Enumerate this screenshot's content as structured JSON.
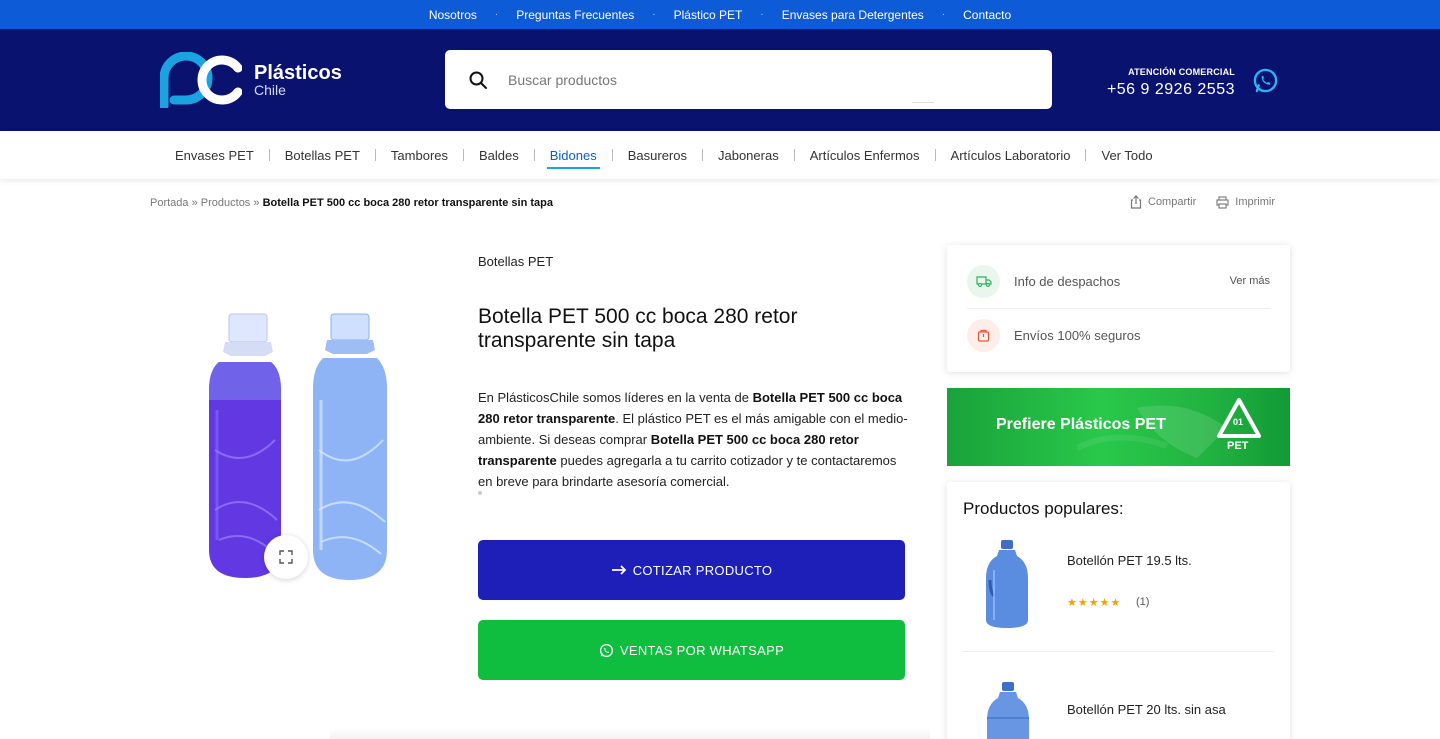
{
  "topbar": {
    "links": [
      "Nosotros",
      "Preguntas Frecuentes",
      "Plástico PET",
      "Envases para Detergentes",
      "Contacto"
    ]
  },
  "header": {
    "logo_line1": "Plásticos",
    "logo_line2": "Chile",
    "search_placeholder": "Buscar productos",
    "contact_label": "ATENCIÓN COMERCIAL",
    "contact_phone": "+56 9 2926 2553"
  },
  "catnav": {
    "items": [
      "Envases PET",
      "Botellas PET",
      "Tambores",
      "Baldes",
      "Bidones",
      "Basureros",
      "Jaboneras",
      "Artículos Enfermos",
      "Artículos Laboratorio",
      "Ver Todo"
    ],
    "active": "Bidones"
  },
  "breadcrumb": {
    "home": "Portada",
    "sep": "»",
    "products": "Productos",
    "current": "Botella PET 500 cc boca 280 retor transparente sin tapa"
  },
  "tools": {
    "share": "Compartir",
    "print": "Imprimir"
  },
  "product": {
    "category": "Botellas PET",
    "title": "Botella PET 500 cc boca 280 retor transparente sin tapa",
    "desc_1": "En PlásticosChile somos líderes en la venta de ",
    "desc_b1": "Botella PET 500 cc boca 280 retor transparente",
    "desc_2": ". El plástico PET es el más amigable con el medio-ambiente. Si deseas comprar ",
    "desc_b2": "Botella PET 500 cc boca 280 retor transparente",
    "desc_3": " puedes agregarla a tu carrito cotizador y te contactaremos en breve para brindarte asesoría comercial.",
    "quote_button": "COTIZAR PRODUCTO",
    "whatsapp_button": "VENTAS POR WHATSAPP"
  },
  "shipping": {
    "info": "Info de despachos",
    "more": "Ver más",
    "secure": "Envíos 100% seguros"
  },
  "banner": {
    "text": "Prefiere Plásticos PET",
    "recycle_code": "01",
    "recycle_label": "PET"
  },
  "popular": {
    "heading": "Productos populares:",
    "items": [
      {
        "name": "Botellón PET 19.5 lts.",
        "stars": "★★★★★",
        "count": "(1)"
      },
      {
        "name": "Botellón PET 20 lts. sin asa"
      }
    ]
  },
  "colors": {
    "topbar": "#0d5bd6",
    "header": "#0a1270",
    "quote_button": "#1d1fb8",
    "whatsapp_button": "#0fbd3f",
    "active_underline": "#1aa3e0"
  }
}
